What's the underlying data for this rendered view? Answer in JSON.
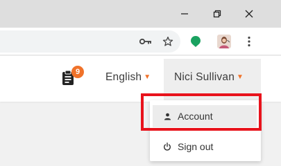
{
  "browser": {
    "controls": {
      "minimize_icon": "minimize-icon",
      "restore_icon": "restore-icon",
      "close_icon": "close-icon"
    },
    "toolbar": {
      "icons": [
        "key-icon",
        "star-icon",
        "extension-icon",
        "profile-avatar",
        "kebab-menu-icon"
      ],
      "extension_color": "#1aa260"
    }
  },
  "header": {
    "notifications": {
      "icon": "clipboard-icon",
      "count": "9"
    },
    "language": {
      "label": "English"
    },
    "user": {
      "name": "Nici Sullivan"
    }
  },
  "dropdown": {
    "items": [
      {
        "label": "Account",
        "icon": "person-icon"
      },
      {
        "label": "Sign out",
        "icon": "power-icon"
      }
    ]
  },
  "colors": {
    "accent": "#f0722a",
    "highlight": "#e8131c"
  }
}
